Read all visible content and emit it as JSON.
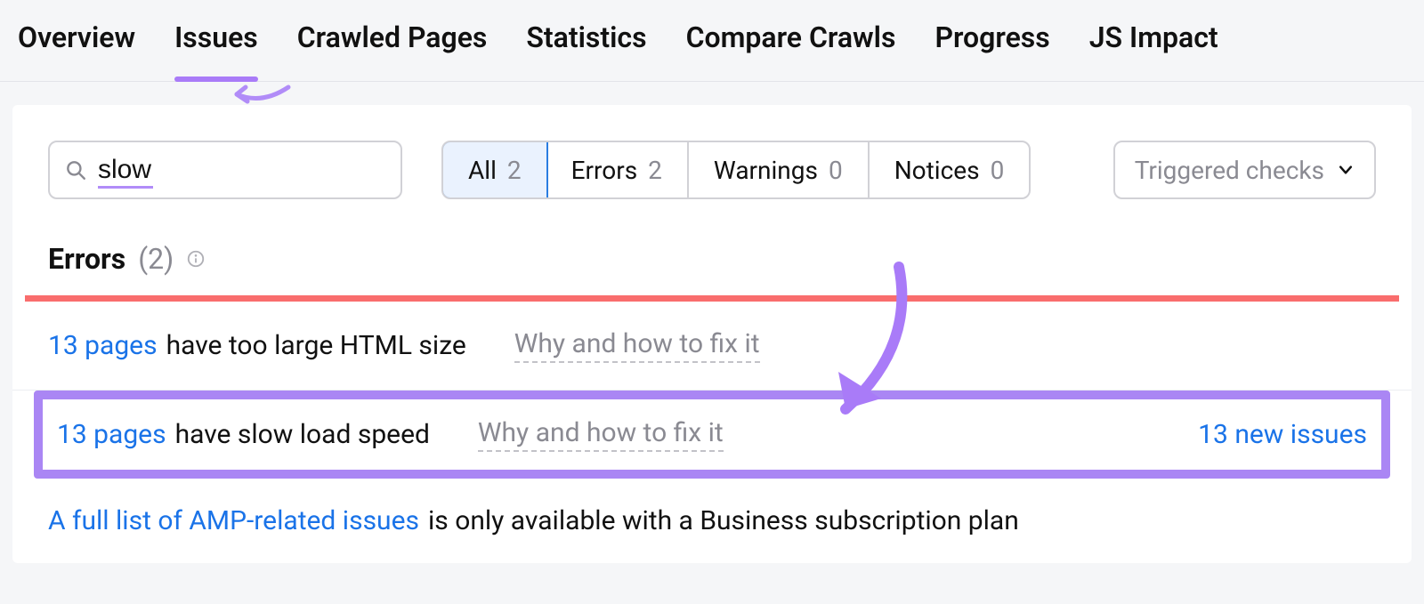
{
  "tabs": [
    {
      "label": "Overview"
    },
    {
      "label": "Issues"
    },
    {
      "label": "Crawled Pages"
    },
    {
      "label": "Statistics"
    },
    {
      "label": "Compare Crawls"
    },
    {
      "label": "Progress"
    },
    {
      "label": "JS Impact"
    }
  ],
  "active_tab_index": 1,
  "search": {
    "value": "slow"
  },
  "filters": {
    "all": {
      "label": "All",
      "count": "2"
    },
    "errors": {
      "label": "Errors",
      "count": "2"
    },
    "warnings": {
      "label": "Warnings",
      "count": "0"
    },
    "notices": {
      "label": "Notices",
      "count": "0"
    }
  },
  "dropdown": {
    "label": "Triggered checks"
  },
  "section": {
    "label": "Errors",
    "count": "(2)"
  },
  "rows": [
    {
      "pages_link": "13 pages",
      "text": "have too large HTML size",
      "hint": "Why and how to fix it"
    },
    {
      "pages_link": "13 pages",
      "text": "have slow load speed",
      "hint": "Why and how to fix it",
      "right": "13 new issues"
    }
  ],
  "amp": {
    "link": "A full list of AMP-related issues",
    "text": "is only available with a Business subscription plan"
  }
}
